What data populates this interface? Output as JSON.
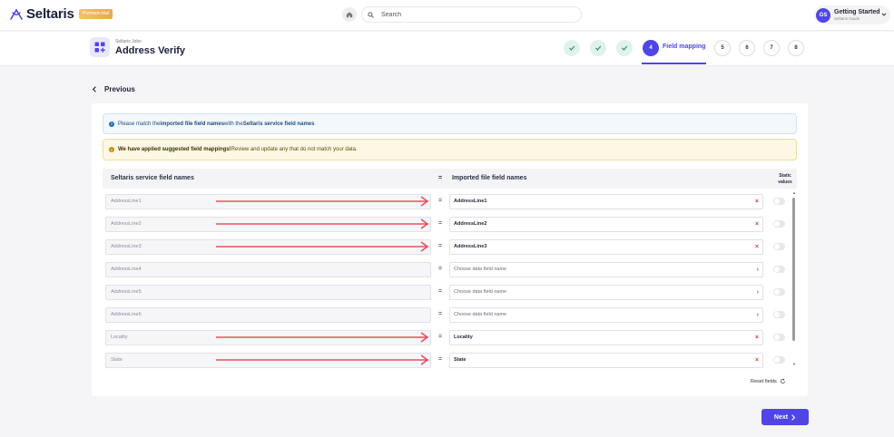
{
  "app": {
    "brand": "Seltaris",
    "badge": "Premium trial",
    "search_placeholder": "Search"
  },
  "user": {
    "initials": "GS",
    "name": "Getting Started",
    "subtitle": "Seltaris Guide"
  },
  "job": {
    "subtitle": "Seltaris Jobs",
    "title": "Address Verify"
  },
  "steps": [
    {
      "label": "",
      "state": "done"
    },
    {
      "label": "",
      "state": "done"
    },
    {
      "label": "",
      "state": "done"
    },
    {
      "label": "4",
      "state": "current"
    },
    {
      "label": "5",
      "state": "future"
    },
    {
      "label": "6",
      "state": "future"
    },
    {
      "label": "7",
      "state": "future"
    },
    {
      "label": "8",
      "state": "future"
    }
  ],
  "current_step_label": "Field mapping",
  "previous_label": "Previous",
  "info": {
    "pre": "Please match the ",
    "bold1": "imported file field names",
    "mid": " with the ",
    "bold2": "Seltaris service field names"
  },
  "warning": {
    "bold": "We have applied suggested field mappings!",
    "text": " Review and update any that do not match your data."
  },
  "table": {
    "col_service": "Seltaris service field names",
    "col_eq": "=",
    "col_imported": "Imported file field names",
    "col_static_1": "Static",
    "col_static_2": "values",
    "rows": [
      {
        "service": "AddressLine1",
        "mapped": "AddressLine1",
        "filled": true
      },
      {
        "service": "AddressLine2",
        "mapped": "AddressLine2",
        "filled": true
      },
      {
        "service": "AddressLine3",
        "mapped": "AddressLine3",
        "filled": true
      },
      {
        "service": "AddressLine4",
        "mapped": "Choose data field name",
        "filled": false
      },
      {
        "service": "AddressLine5",
        "mapped": "Choose data field name",
        "filled": false
      },
      {
        "service": "AddressLine6",
        "mapped": "Choose data field name",
        "filled": false
      },
      {
        "service": "Locality",
        "mapped": "Locality",
        "filled": true
      },
      {
        "service": "State",
        "mapped": "State",
        "filled": true
      }
    ]
  },
  "reset_label": "Reset fields",
  "next_label": "Next",
  "colors": {
    "accent": "#4f46e5",
    "arrow": "#e8505b",
    "remove": "#d93c3c"
  }
}
